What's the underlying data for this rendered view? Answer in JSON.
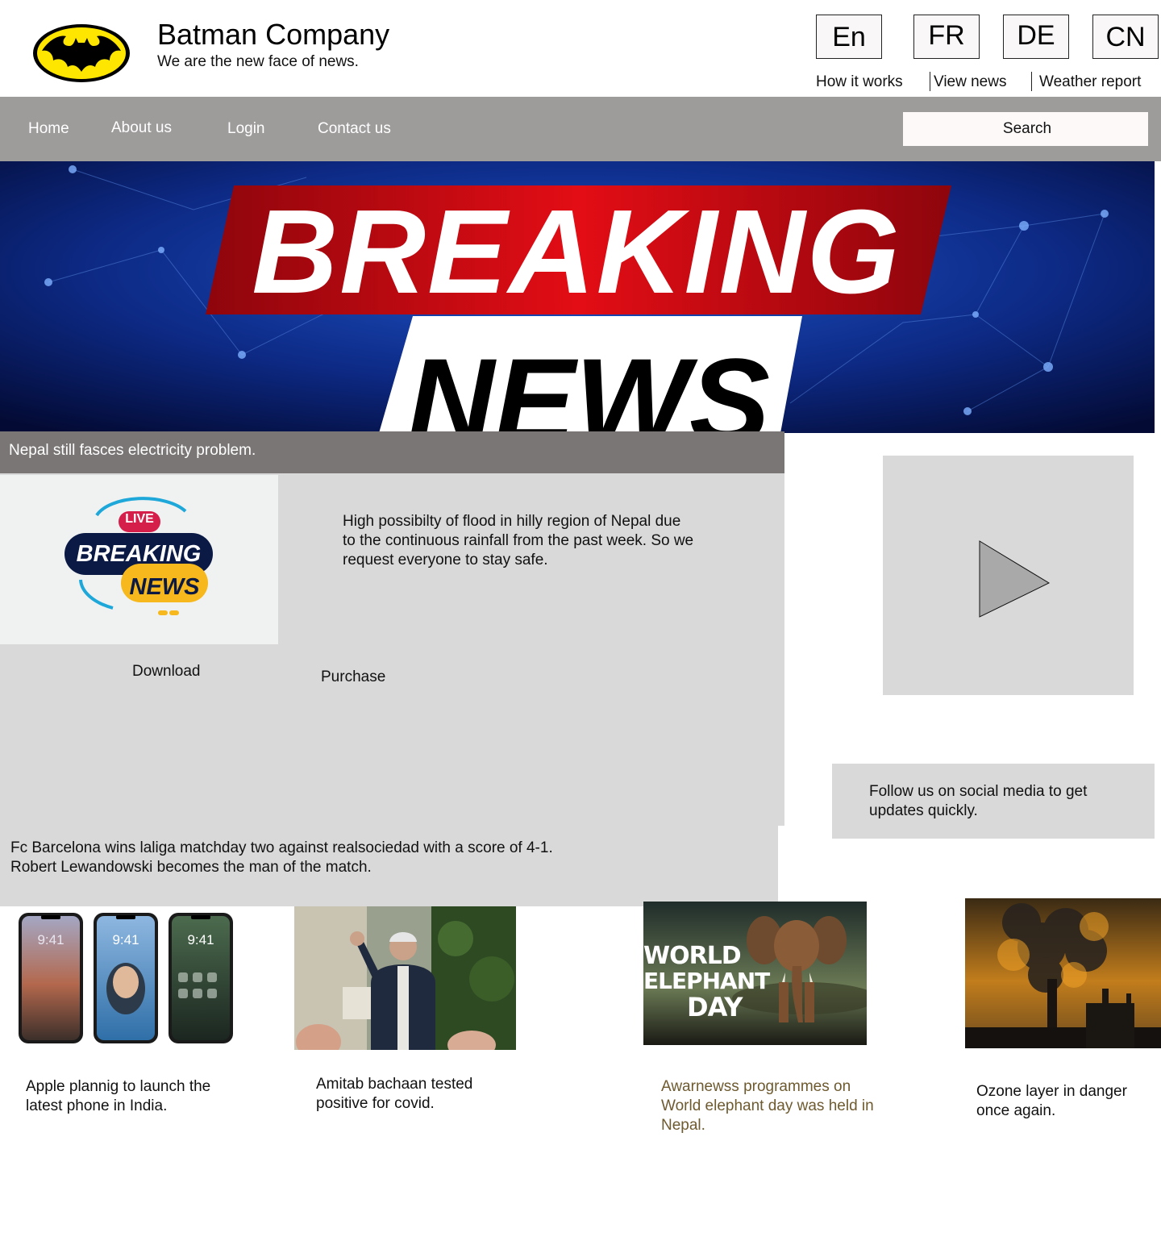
{
  "header": {
    "company_name": "Batman Company",
    "tagline": "We are the new face of news.",
    "logo": "bat-logo"
  },
  "languages": [
    "En",
    "FR",
    "DE",
    "CN"
  ],
  "top_links": [
    "How it works",
    "View news",
    "Weather report"
  ],
  "nav": {
    "items": [
      "Home",
      "About us",
      "Login",
      "Contact us"
    ],
    "search_placeholder": "Search"
  },
  "hero": {
    "line1": "BREAKING",
    "line2": "NEWS"
  },
  "headline": "Nepal still fasces electricity problem.",
  "main_story": {
    "thumb": {
      "badge": "LIVE",
      "line1": "BREAKING",
      "line2": "NEWS"
    },
    "text": "High possibilty of flood in hilly region of Nepal due to the continuous rainfall from the past week. So we request everyone to stay safe.",
    "download_label": "Download",
    "purchase_label": "Purchase"
  },
  "video": {
    "icon": "play-icon"
  },
  "social": {
    "text": "Follow us on social media to get updates quickly."
  },
  "barca": {
    "text": "Fc Barcelona wins laliga matchday two against realsociedad with a score of 4-1. Robert Lewandowski becomes the man of the match."
  },
  "cards": [
    {
      "caption": "Apple plannig to launch the latest phone in India.",
      "image": "phones-image",
      "phone_time": "9:41"
    },
    {
      "caption": "Amitab bachaan tested positive for covid.",
      "image": "person-waving-image"
    },
    {
      "caption": "Awarnewss programmes on World elephant day was held in Nepal.",
      "image": "elephant-image",
      "image_text": [
        "WORLD",
        "ELEPHANT",
        "DAY"
      ]
    },
    {
      "caption": "Ozone layer in danger once again.",
      "image": "factory-smoke-image"
    }
  ],
  "colors": {
    "nav_bg": "#9e9b9b",
    "headline_bg": "#7b7676",
    "panel_bg": "#d9d9d9",
    "breaking_red": "#d20a12",
    "hero_blue": "#0d2a86"
  }
}
